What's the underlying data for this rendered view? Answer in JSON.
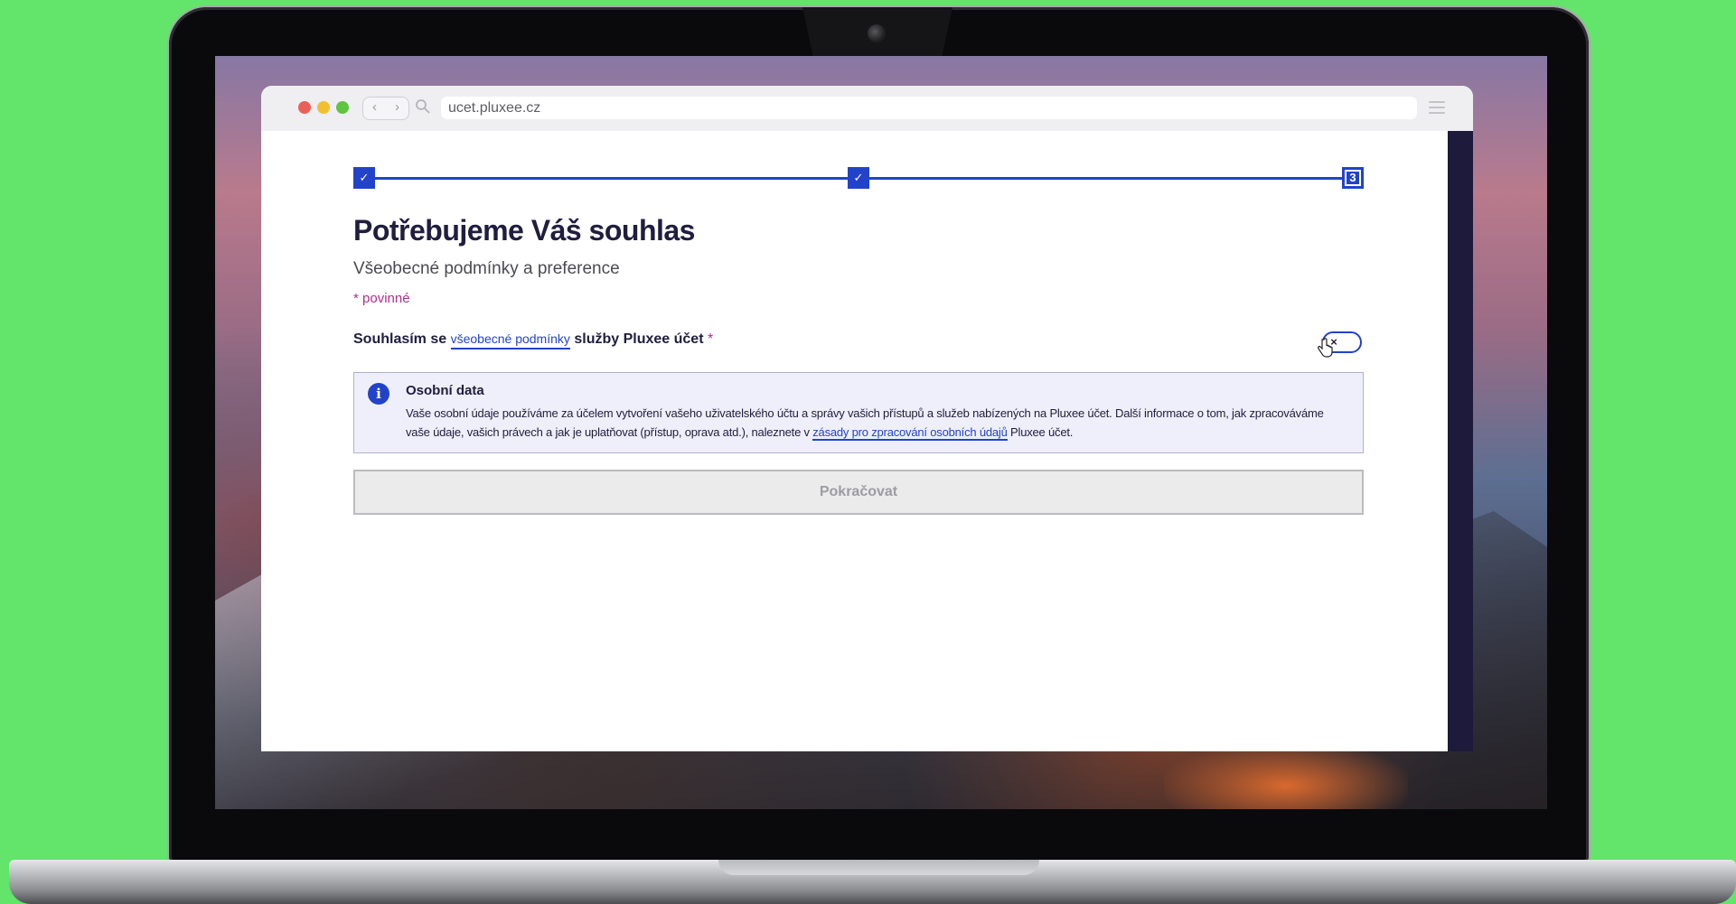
{
  "browser": {
    "url": "ucet.pluxee.cz",
    "nav_back": "‹",
    "nav_forward": "›"
  },
  "stepper": {
    "steps": [
      {
        "state": "done",
        "symbol": "✓"
      },
      {
        "state": "done",
        "symbol": "✓"
      },
      {
        "state": "current",
        "symbol": "3"
      }
    ]
  },
  "page": {
    "title": "Potřebujeme Váš souhlas",
    "subtitle": "Všeobecné podmínky a preference",
    "required_note": "* povinné"
  },
  "consent": {
    "prefix": "Souhlasím se ",
    "link": "všeobecné podmínky",
    "suffix": " služby Pluxee účet",
    "required_mark": "*",
    "toggle_symbol": "×",
    "toggle_on": false
  },
  "info": {
    "icon": "i",
    "title": "Osobní data",
    "text_part1": "Vaše osobní údaje používáme za účelem vytvoření vašeho uživatelského účtu a správy vašich přístupů a služeb nabízených na Pluxee účet. Další informace o tom, jak zpracováváme vaše údaje, vašich právech a jak je uplatňovat (přístup, oprava atd.), naleznete v ",
    "link": "zásady pro zpracování osobních údajů",
    "text_part2": " Pluxee účet."
  },
  "actions": {
    "continue_label": "Pokračovat"
  },
  "colors": {
    "brand_blue": "#2243c9",
    "heading_navy": "#201d3f",
    "required_magenta": "#b02f8a",
    "background_green": "#63e46a"
  }
}
